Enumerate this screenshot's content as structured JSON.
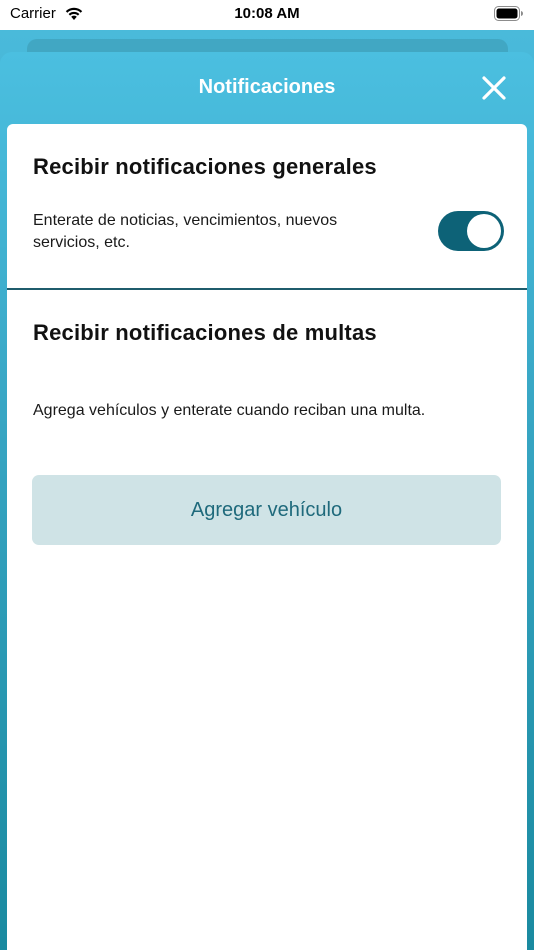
{
  "status_bar": {
    "carrier": "Carrier",
    "time": "10:08 AM",
    "wifi_icon": "wifi-icon",
    "battery_icon": "battery-icon"
  },
  "sheet": {
    "title": "Notificaciones",
    "close_icon": "close-icon"
  },
  "general": {
    "title": "Recibir notificaciones generales",
    "description": "Enterate de noticias, vencimientos, nuevos servicios, etc.",
    "toggle_on": true
  },
  "fines": {
    "title": "Recibir notificaciones de multas",
    "description": "Agrega vehículos y enterate cuando reciban una multa.",
    "button_label": "Agregar vehículo"
  },
  "colors": {
    "header_top": "#4bbfe0",
    "header_bottom": "#1a8aa0",
    "toggle_on": "#0d6277",
    "button_bg": "#cfe3e6",
    "button_text": "#1f6a7c"
  }
}
